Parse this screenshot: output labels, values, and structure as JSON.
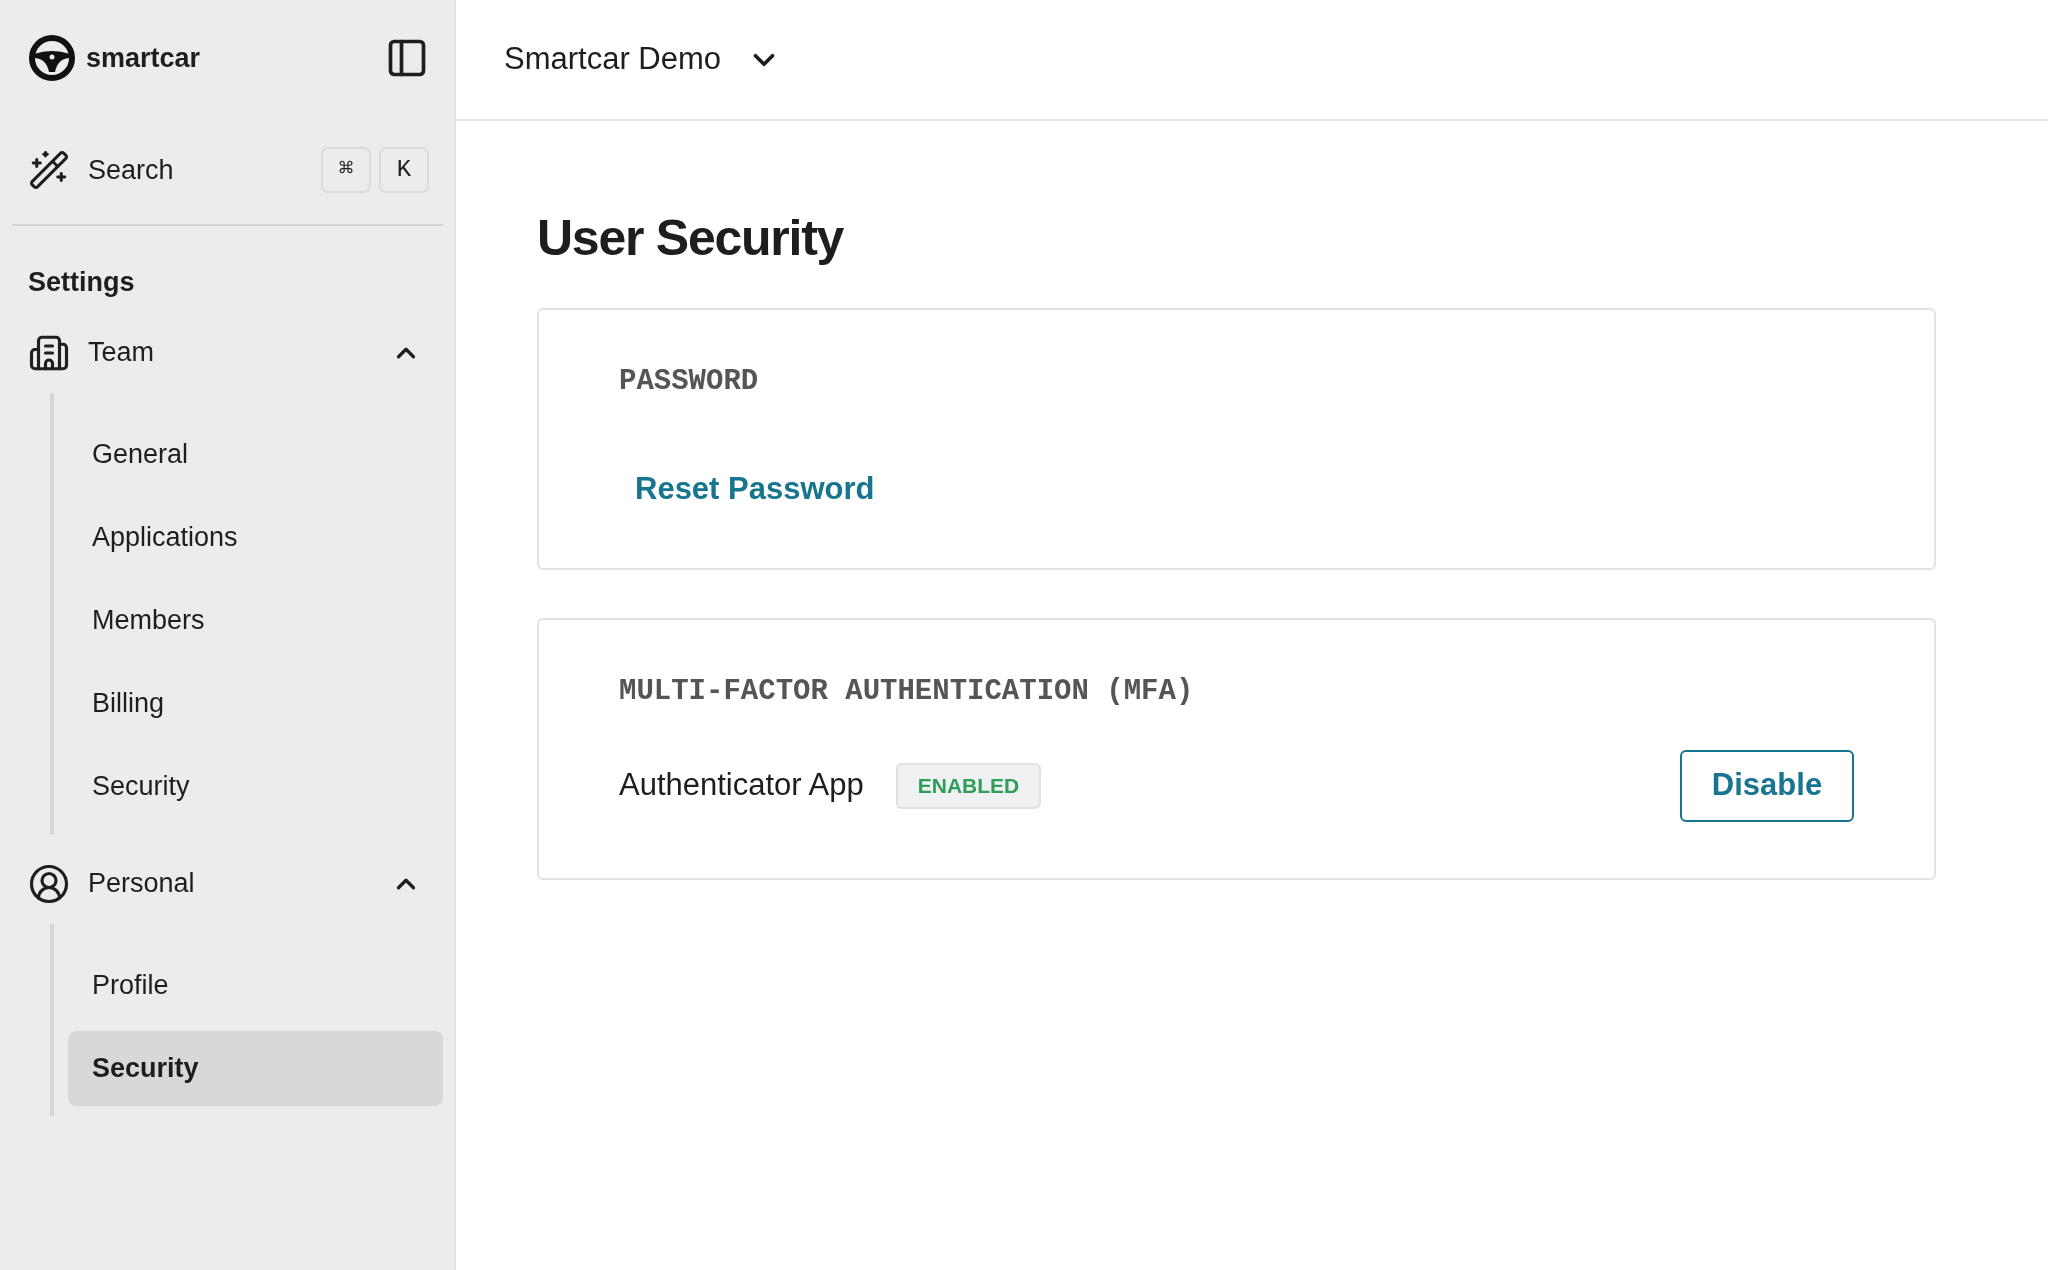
{
  "sidebar": {
    "brand": "smartcar",
    "search": {
      "label": "Search",
      "keys": [
        "⌘",
        "K"
      ]
    },
    "section_title": "Settings",
    "groups": [
      {
        "label": "Team",
        "expanded": true,
        "children": [
          {
            "label": "General",
            "selected": false
          },
          {
            "label": "Applications",
            "selected": false
          },
          {
            "label": "Members",
            "selected": false
          },
          {
            "label": "Billing",
            "selected": false
          },
          {
            "label": "Security",
            "selected": false
          }
        ]
      },
      {
        "label": "Personal",
        "expanded": true,
        "children": [
          {
            "label": "Profile",
            "selected": false
          },
          {
            "label": "Security",
            "selected": true
          }
        ]
      }
    ]
  },
  "header": {
    "workspace": "Smartcar Demo"
  },
  "page_title": "User Security",
  "password_card": {
    "heading": "PASSWORD",
    "link": "Reset Password"
  },
  "mfa_card": {
    "heading": "MULTI-FACTOR AUTHENTICATION (MFA)",
    "method": "Authenticator App",
    "status": "ENABLED",
    "enabled": true,
    "button": "Disable"
  }
}
